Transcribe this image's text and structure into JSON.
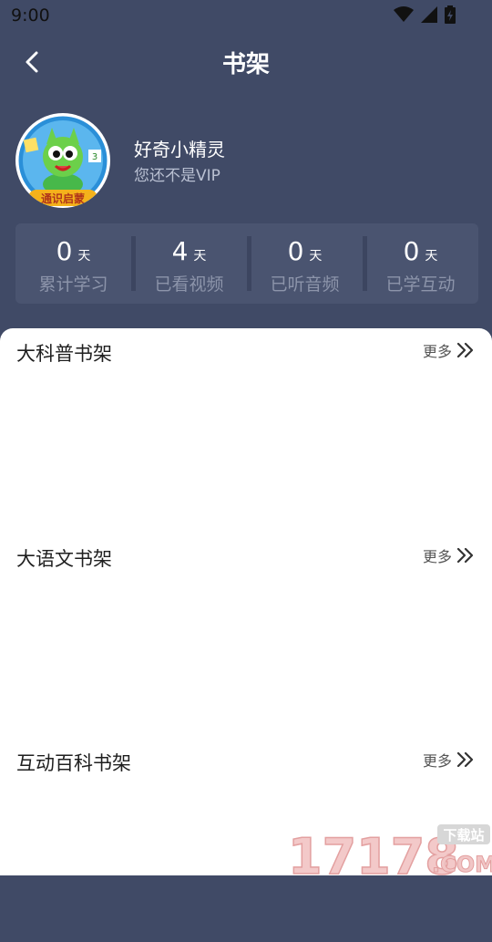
{
  "status_bar": {
    "time": "9:00",
    "icons": [
      "wifi-icon",
      "signal-icon",
      "battery-icon"
    ]
  },
  "header": {
    "title": "书架",
    "back_icon": "chevron-left-icon"
  },
  "profile": {
    "name": "好奇小精灵",
    "vip_status": "您还不是VIP",
    "avatar_badge": "通识启蒙"
  },
  "stats": [
    {
      "value": "0",
      "unit": "天",
      "label": "累计学习"
    },
    {
      "value": "4",
      "unit": "天",
      "label": "已看视频"
    },
    {
      "value": "0",
      "unit": "天",
      "label": "已听音频"
    },
    {
      "value": "0",
      "unit": "天",
      "label": "已学互动"
    }
  ],
  "shelves": [
    {
      "title": "大科普书架",
      "more": "更多"
    },
    {
      "title": "大语文书架",
      "more": "更多"
    },
    {
      "title": "互动百科书架",
      "more": "更多"
    }
  ],
  "watermark": {
    "digits": "17178",
    "suffix": ".COM",
    "tag": "下载站"
  },
  "colors": {
    "header_bg": "#404a66",
    "stats_bg": "#4a5470",
    "panel_bg": "#ffffff",
    "label_muted": "#8c94aa"
  }
}
